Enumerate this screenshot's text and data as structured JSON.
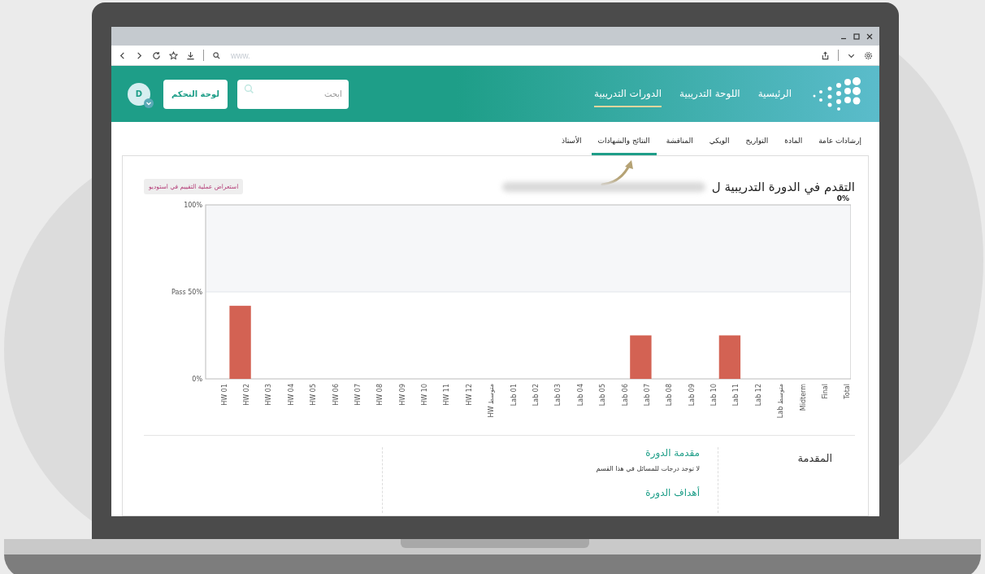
{
  "browser": {
    "address_placeholder": "www."
  },
  "header": {
    "nav": [
      {
        "label": "الرئيسية",
        "selected": false
      },
      {
        "label": "اللوحة التدريبية",
        "selected": false
      },
      {
        "label": "الدورات التدريبية",
        "selected": true
      }
    ],
    "search": {
      "placeholder": "ابحث"
    },
    "dashboard_button": "لوحة التحكم",
    "avatar": "D"
  },
  "tabs": [
    {
      "label": "إرشادات عامة",
      "selected": false
    },
    {
      "label": "المادة",
      "selected": false
    },
    {
      "label": "التواريخ",
      "selected": false
    },
    {
      "label": "الويكي",
      "selected": false
    },
    {
      "label": "المناقشة",
      "selected": false
    },
    {
      "label": "النتائج والشهادات",
      "selected": true
    },
    {
      "label": "الأستاذ",
      "selected": false
    }
  ],
  "progress": {
    "heading": "التقدم في الدورة التدريبية ل",
    "studio_button": "استعراض عملية التقييم في استوديو",
    "total_label": "0%",
    "chart_data": {
      "type": "bar",
      "categories": [
        "HW 01",
        "HW 02",
        "HW 03",
        "HW 04",
        "HW 05",
        "HW 06",
        "HW 07",
        "HW 08",
        "HW 09",
        "HW 10",
        "HW 11",
        "HW 12",
        "HW متوسط",
        "Lab 01",
        "Lab 02",
        "Lab 03",
        "Lab 04",
        "Lab 05",
        "Lab 06",
        "Lab 07",
        "Lab 08",
        "Lab 09",
        "Lab 10",
        "Lab 11",
        "Lab 12",
        "Lab متوسط",
        "Midterm",
        "Final",
        "Total"
      ],
      "values": [
        0,
        42,
        0,
        0,
        0,
        0,
        0,
        0,
        0,
        0,
        0,
        0,
        0,
        0,
        0,
        0,
        0,
        0,
        0,
        25,
        0,
        0,
        0,
        25,
        0,
        0,
        0,
        0,
        0
      ],
      "ylim": [
        0,
        100
      ],
      "yticks": [
        {
          "value": 0,
          "label": "0%"
        },
        {
          "value": 50,
          "label": "Pass 50%"
        },
        {
          "value": 100,
          "label": "100%"
        }
      ]
    }
  },
  "sections": {
    "title": "المقدمة",
    "items": [
      {
        "heading": "مقدمة الدورة",
        "text": "لا توجد درجات للمسائل في هذا القسم"
      },
      {
        "heading": "أهداف الدورة"
      }
    ]
  }
}
